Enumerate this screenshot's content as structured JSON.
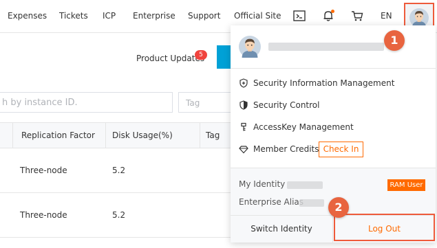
{
  "nav": {
    "links": [
      "Expenses",
      "Tickets",
      "ICP",
      "Enterprise",
      "Support",
      "Official Site"
    ],
    "lang": "EN",
    "icons": [
      "terminal-icon",
      "bell-icon",
      "cart-icon"
    ],
    "accent": "#ff6a00"
  },
  "page": {
    "product_updates": "Product Updates",
    "updates_count": "5",
    "search_placeholder": "h by instance ID.",
    "tag_placeholder": "Tag",
    "columns": [
      "Replication Factor",
      "Disk Usage(%)",
      "Tag"
    ],
    "rows": [
      {
        "replication": "Three-node",
        "disk": "5.2"
      },
      {
        "replication": "Three-node",
        "disk": "5.2"
      }
    ]
  },
  "dropdown": {
    "menu": [
      {
        "label": "Security Information Management",
        "icon": "shield-plus-icon"
      },
      {
        "label": "Security Control",
        "icon": "shield-icon"
      },
      {
        "label": "AccessKey Management",
        "icon": "key-icon"
      },
      {
        "label": "Member Credits",
        "icon": "diamond-icon"
      }
    ],
    "check_in": "Check In",
    "my_identity_label": "My Identity",
    "enterprise_alias_label": "Enterprise Alias",
    "ram_user": "RAM User",
    "switch_identity": "Switch Identity",
    "log_out": "Log Out"
  },
  "annotations": {
    "step1": "1",
    "step2": "2",
    "color": "#e8643f"
  }
}
